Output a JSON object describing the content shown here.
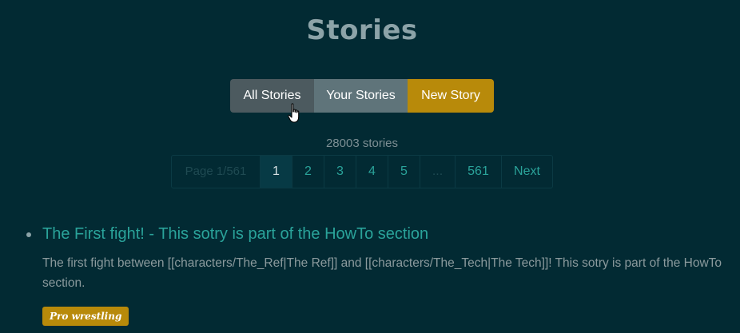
{
  "header": {
    "title": "Stories"
  },
  "nav_buttons": {
    "all": "All Stories",
    "yours": "Your Stories",
    "new": "New Story"
  },
  "story_count": "28003 stories",
  "pagination": {
    "info": "Page 1/561",
    "pages": [
      "1",
      "2",
      "3",
      "4",
      "5"
    ],
    "ellipsis": "...",
    "last": "561",
    "next": "Next",
    "current": "1"
  },
  "stories": [
    {
      "title": "The First fight! - This sotry is part of the HowTo section",
      "description": "The first fight between [[characters/The_Ref|The Ref]] and [[characters/The_Tech|The Tech]]! This sotry is part of the HowTo section.",
      "tag": "Pro wrestling"
    }
  ],
  "colors": {
    "background": "#022a33",
    "accent": "#2aa39a",
    "brand_gold": "#b88a0a"
  }
}
